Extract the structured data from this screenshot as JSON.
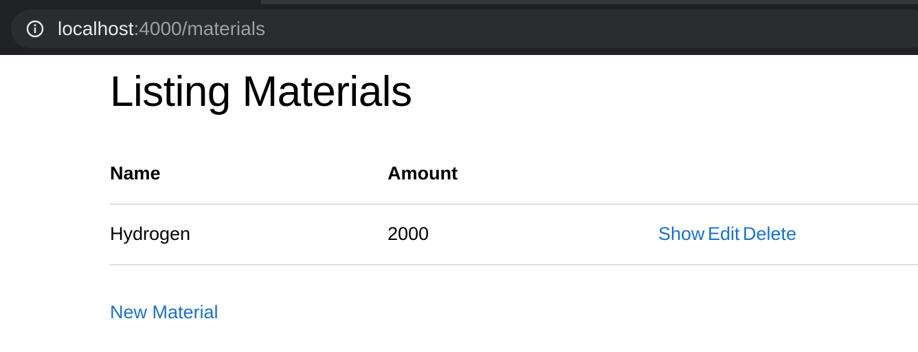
{
  "browser": {
    "url_host": "localhost",
    "url_path": ":4000/materials",
    "icon": "info-icon"
  },
  "page": {
    "title": "Listing Materials"
  },
  "table": {
    "headers": [
      "Name",
      "Amount"
    ],
    "rows": [
      {
        "name": "Hydrogen",
        "amount": "2000",
        "actions": [
          "Show",
          "Edit",
          "Delete"
        ]
      }
    ]
  },
  "links": {
    "new_label": "New Material"
  },
  "colors": {
    "chrome_bg": "#202124",
    "link": "#1a73c8",
    "rule": "#dedede"
  }
}
